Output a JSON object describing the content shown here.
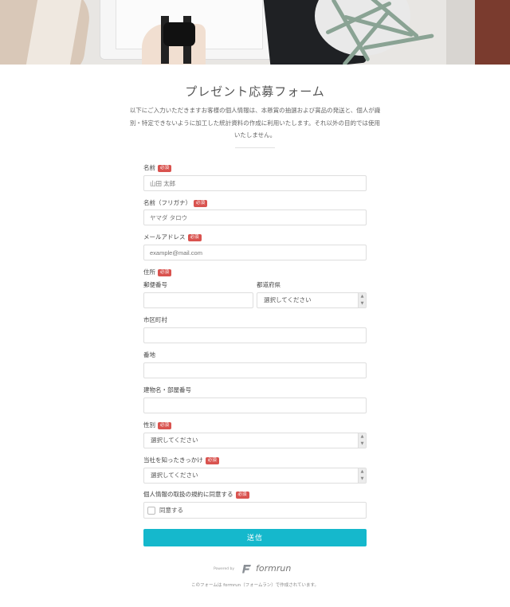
{
  "header": {
    "title": "プレゼント応募フォーム",
    "description": "以下にご入力いただきますお客様の個人情報は、本懸賞の抽選および賞品の発送と、個人が識別・特定できないように加工した統計資料の作成に利用いたします。それ以外の目的では使用いたしません。"
  },
  "form": {
    "required_badge": "必須",
    "name": {
      "label": "名前",
      "placeholder": "山田 太郎"
    },
    "kana": {
      "label": "名前（フリガナ）",
      "placeholder": "ヤマダ タロウ"
    },
    "email": {
      "label": "メールアドレス",
      "placeholder": "example@mail.com"
    },
    "address": {
      "label": "住所",
      "postal_label": "郵便番号",
      "prefecture_label": "都道府県",
      "prefecture_value": "選択してください",
      "city_label": "市区町村",
      "street_label": "番地",
      "building_label": "建物名・部屋番号"
    },
    "gender": {
      "label": "性別",
      "value": "選択してください"
    },
    "referral": {
      "label": "当社を知ったきっかけ",
      "value": "選択してください"
    },
    "consent": {
      "label": "個人情報の取扱の規約に同意する",
      "checkbox_label": "同意する",
      "checked": false
    },
    "submit_label": "送信"
  },
  "footer": {
    "powered_by": "Powered by",
    "brand": "formrun",
    "note": "このフォームは formrun（フォームラン）で作成されています。"
  },
  "colors": {
    "accent": "#15b8cc",
    "required_badge": "#d9534f"
  },
  "icons": {
    "select_arrow": "updown-arrow-icon",
    "brand_logo": "formrun-logo-icon"
  }
}
